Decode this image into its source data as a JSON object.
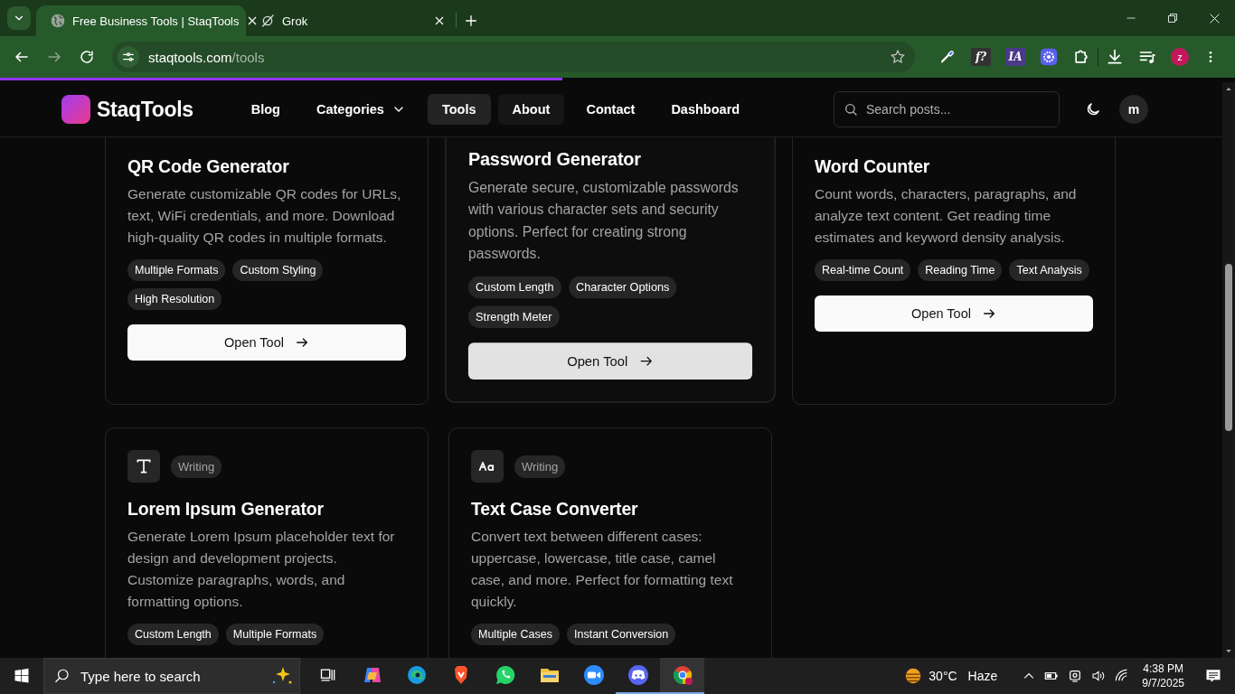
{
  "browser": {
    "tabs": [
      {
        "title": "Free Business Tools | StaqTools",
        "kind": "globe",
        "selected": true
      },
      {
        "title": "Grok",
        "kind": "grok",
        "selected": false
      }
    ],
    "address": {
      "host": "staqtools.com",
      "path": "/tools"
    },
    "extensions": [
      {
        "kind": "eyedropper"
      },
      {
        "kind": "badge",
        "label": "f?",
        "color": "#333333"
      },
      {
        "kind": "badge",
        "label": "IA",
        "color": "#4a3a8a"
      },
      {
        "kind": "flower"
      },
      {
        "kind": "puzzle"
      }
    ],
    "profile": "z",
    "loading": {
      "level": 0.455
    }
  },
  "header": {
    "logo": "StaqTools",
    "nav": [
      {
        "label": "Blog",
        "selected": false,
        "hovered": false
      },
      {
        "label": "Categories",
        "selected": false,
        "hovered": false,
        "dropdown": true
      },
      {
        "label": "Tools",
        "selected": true,
        "hovered": false
      },
      {
        "label": "About",
        "selected": false,
        "hovered": true
      },
      {
        "label": "Contact",
        "selected": false,
        "hovered": false
      },
      {
        "label": "Dashboard",
        "selected": false,
        "hovered": false
      }
    ],
    "search": {
      "placeholder": "Search posts..."
    },
    "user": "m"
  },
  "cards": [
    {
      "title": "QR Code Generator",
      "description": "Generate customizable QR codes for URLs, text, WiFi credentials, and more. Download high-quality QR codes in multiple formats.",
      "tags": [
        "Multiple Formats",
        "Custom Styling",
        "High Resolution"
      ],
      "button": "Open Tool",
      "hovered": false
    },
    {
      "title": "Password Generator",
      "description": "Generate secure, customizable passwords with various character sets and security options. Perfect for creating strong passwords.",
      "tags": [
        "Custom Length",
        "Character Options",
        "Strength Meter"
      ],
      "button": "Open Tool",
      "hovered": true
    },
    {
      "title": "Word Counter",
      "description": "Count words, characters, paragraphs, and analyze text content. Get reading time estimates and keyword density analysis.",
      "tags": [
        "Real-time Count",
        "Reading Time",
        "Text Analysis"
      ],
      "button": "Open Tool",
      "hovered": false
    },
    {
      "kind": "type",
      "category": "Writing",
      "title": "Lorem Ipsum Generator",
      "description": "Generate Lorem Ipsum placeholder text for design and development projects. Customize paragraphs, words, and formatting options.",
      "tags": [
        "Custom Length",
        "Multiple Formats"
      ],
      "hovered": false
    },
    {
      "kind": "case",
      "category": "Writing",
      "title": "Text Case Converter",
      "description": "Convert text between different cases: uppercase, lowercase, title case, camel case, and more. Perfect for formatting text quickly.",
      "tags": [
        "Multiple Cases",
        "Instant Conversion"
      ],
      "hovered": false
    }
  ],
  "taskbar": {
    "search": {
      "placeholder": "Type here to search"
    },
    "apps": [
      {
        "kind": "taskview",
        "open": false,
        "selected": false
      },
      {
        "kind": "copilot",
        "open": false,
        "selected": false
      },
      {
        "kind": "edge",
        "open": false,
        "selected": false
      },
      {
        "kind": "brave",
        "open": false,
        "selected": false
      },
      {
        "kind": "whatsapp",
        "open": false,
        "selected": false
      },
      {
        "kind": "explorer",
        "open": false,
        "selected": false
      },
      {
        "kind": "zoom",
        "open": false,
        "selected": false
      },
      {
        "kind": "discord",
        "open": true,
        "selected": false
      },
      {
        "kind": "chrome",
        "open": true,
        "selected": true
      }
    ],
    "weather": {
      "temperature": "30°C",
      "condition": "Haze"
    },
    "time": "4:38 PM",
    "date": "9/7/2025"
  }
}
